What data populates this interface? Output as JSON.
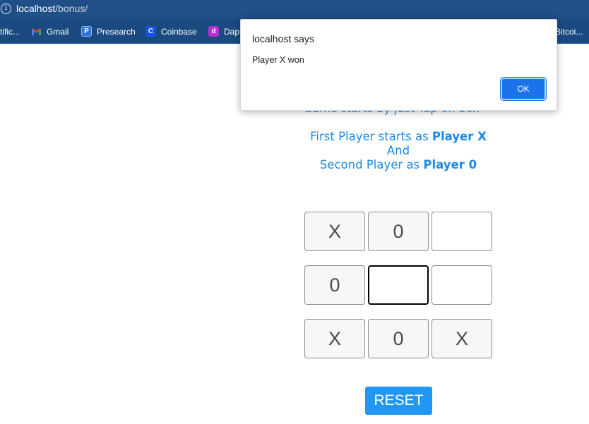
{
  "browser": {
    "url_host": "localhost",
    "url_path": "/bonus/",
    "bookmarks": [
      {
        "label": "tific...",
        "icon": "truncated-bookmark"
      },
      {
        "label": "Gmail",
        "icon": "gmail-icon"
      },
      {
        "label": "Presearch",
        "icon": "presearch-icon"
      },
      {
        "label": "Coinbase",
        "icon": "coinbase-icon"
      },
      {
        "label": "Dap",
        "icon": "dapp-icon"
      },
      {
        "label": "Bitcoi...",
        "icon": "truncated-bookmark"
      }
    ]
  },
  "page": {
    "heading": "Game starts by just Tap on box",
    "intro_line1_prefix": "First Player starts as ",
    "intro_line1_bold": "Player X",
    "intro_line2": "And",
    "intro_line3_prefix": "Second Player as ",
    "intro_line3_bold": "Player 0",
    "board": [
      [
        "X",
        "0",
        ""
      ],
      [
        "0",
        "",
        ""
      ],
      [
        "X",
        "0",
        "X"
      ]
    ],
    "reset_label": "RESET"
  },
  "dialog": {
    "title": "localhost says",
    "message": "Player X won",
    "ok_label": "OK"
  },
  "colors": {
    "chrome": "#1f4f86",
    "text_blue": "#1e88e5",
    "button_blue": "#2196f3",
    "ok_blue": "#1a73e8"
  }
}
